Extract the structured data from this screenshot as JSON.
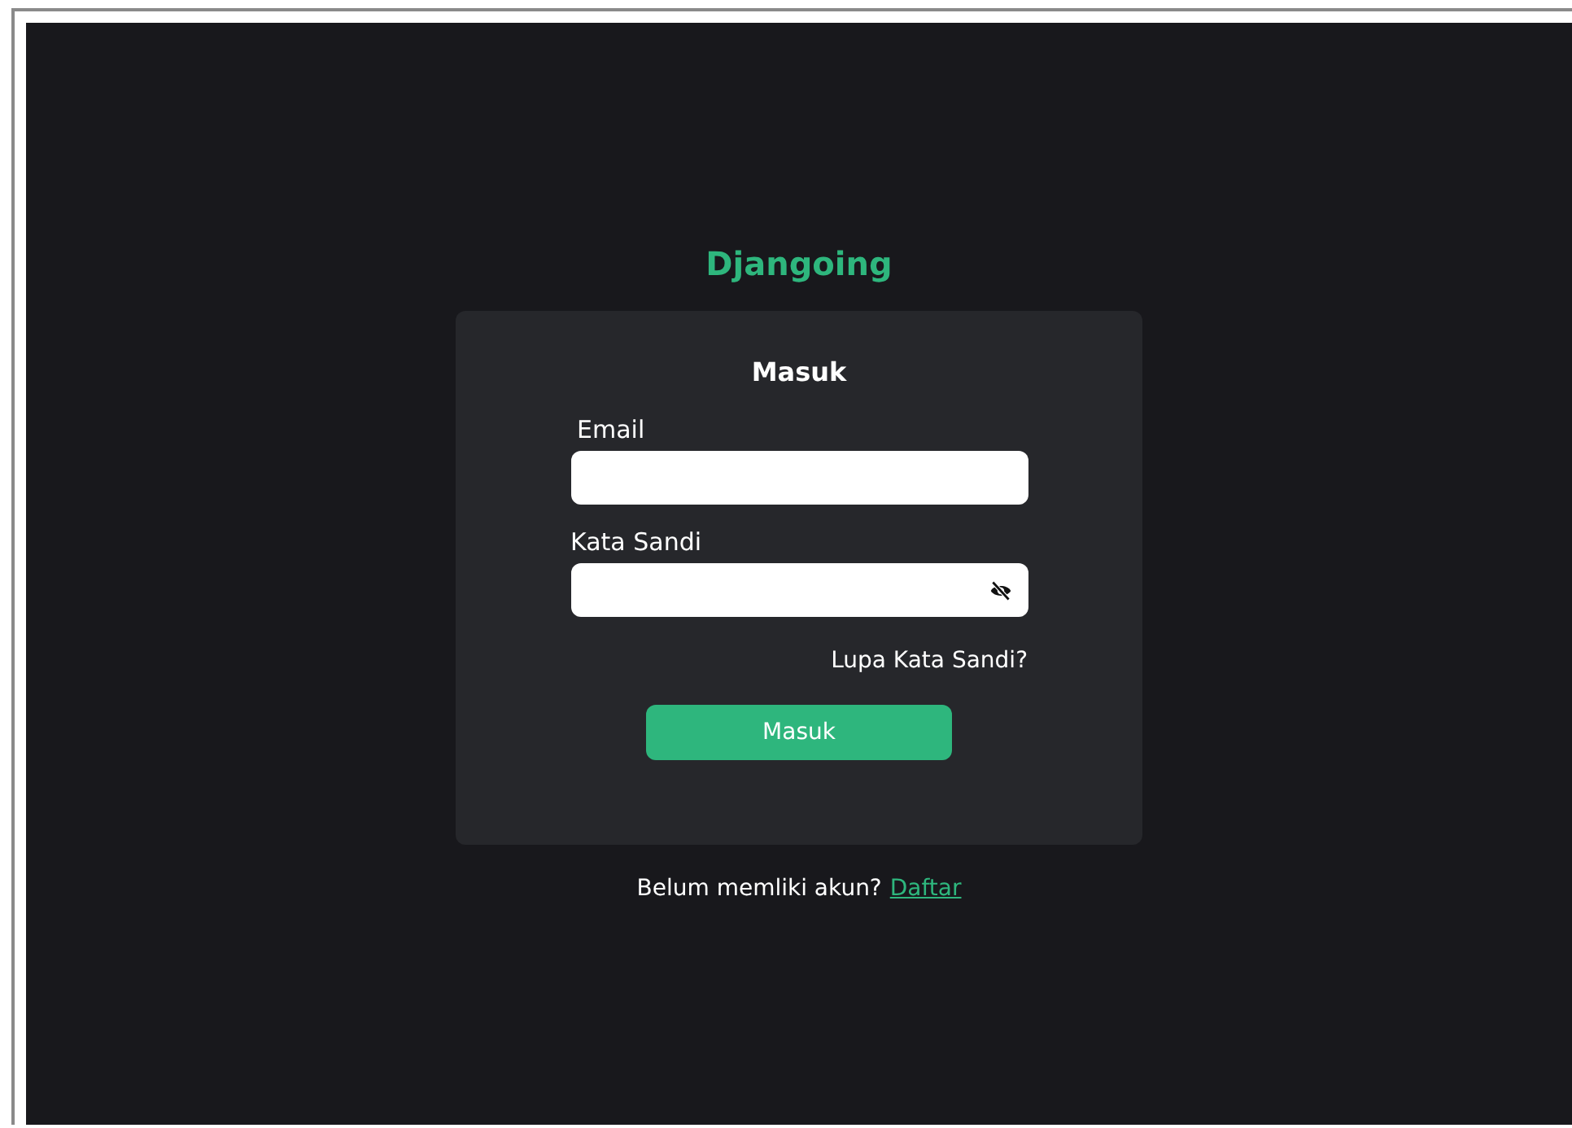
{
  "brand": "Djangoing",
  "card": {
    "title": "Masuk",
    "fields": [
      {
        "label": "Email",
        "kind": "text"
      },
      {
        "label": "Kata Sandi",
        "kind": "password"
      }
    ],
    "forgot_link": "Lupa Kata Sandi?",
    "submit_button": "Masuk"
  },
  "footer": {
    "text": "Belum memliki akun?",
    "link": "Daftar"
  }
}
